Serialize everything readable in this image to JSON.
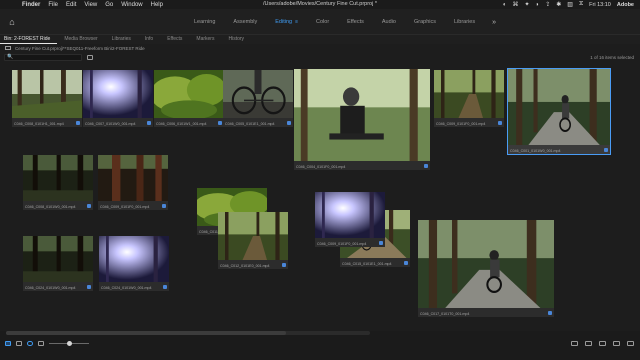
{
  "menubar": {
    "apple_glyph": "",
    "items": [
      {
        "label": "Finder",
        "bold": true
      },
      {
        "label": "File"
      },
      {
        "label": "Edit"
      },
      {
        "label": "View"
      },
      {
        "label": "Go"
      },
      {
        "label": "Window"
      },
      {
        "label": "Help"
      }
    ],
    "doc_path": "/Users/adobe/Movies/Century Fine Cut.prproj *",
    "time": "Fri 13:10",
    "user": "Adobe",
    "tray_glyphs": [
      "◐",
      "⌘",
      "✦",
      "◗",
      "⇪",
      "✱",
      "▥",
      "⧖"
    ]
  },
  "workspace": {
    "home_glyph": "⌂",
    "tabs": [
      "Learning",
      "Assembly",
      "Editing",
      "Color",
      "Effects",
      "Audio",
      "Graphics",
      "Libraries"
    ],
    "active": "Editing",
    "active_menu_glyph": "≡",
    "more_glyph": "»"
  },
  "panel_tabs": {
    "items": [
      "Bin: 2-FOREST Ride",
      "Media Browser",
      "Libraries",
      "Info",
      "Effects",
      "Markers",
      "History"
    ],
    "active": "Bin: 2-FOREST Ride",
    "menu_glyph": "≡"
  },
  "breadcrumb": "Century Fine Cut.prproj\\**SEQ011-Freeform Bin\\2-FOREST Ride",
  "search": {
    "placeholder": "",
    "icon": "🔍",
    "status": "1 of 16 items selected"
  },
  "clips": [
    {
      "name": "C046_C008_0101H1_001.mp4",
      "scene": "forest-light"
    },
    {
      "name": "C046_C007_0101W0_001.mp4",
      "scene": "sun-flare"
    },
    {
      "name": "C046_C006_0101W1_001.mp4",
      "scene": "moss"
    },
    {
      "name": "C046_C005_0101E1_001.mp4",
      "scene": "bike-wheels"
    },
    {
      "name": "C046_C004_0101F0_001.mp4",
      "scene": "cyclist-close"
    },
    {
      "name": "C046_C009_0101F0_001.mp4",
      "scene": "forest-trail"
    },
    {
      "name": "C046_C001_0101W0_001.mp4",
      "scene": "cyclist-road"
    },
    {
      "name": "C046_C008_0101W0_001.mp4",
      "scene": "forest-dark"
    },
    {
      "name": "C046_C009_0101F0_001.mp4",
      "scene": "redwoods"
    },
    {
      "name": "C046_C011_0101W0_001.mp4",
      "scene": "moss"
    },
    {
      "name": "C046_C012_0101E0_001.mp4",
      "scene": "forest-trail"
    },
    {
      "name": "C046_C024_0101W0_001.mp4",
      "scene": "forest-dark"
    },
    {
      "name": "C046_C015_0101E1_001.mp4",
      "scene": "cyclist-trail"
    },
    {
      "name": "C046_C024_0101W0_001.mp4",
      "scene": "sun-flare"
    },
    {
      "name": "C046_C009_0101F0_001.mp4",
      "scene": "sun-flare"
    },
    {
      "name": "C046_C017_0101T0_001.mp4",
      "scene": "cyclist-road"
    }
  ],
  "selected_clip_index": 6,
  "zoom": {
    "level": 0.5
  }
}
